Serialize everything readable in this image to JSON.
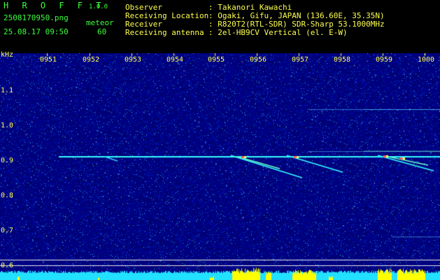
{
  "app": {
    "name": "H R O F F T",
    "version": "1.0.0"
  },
  "file": {
    "name": "2508170950.png",
    "datetime": "25.08.17 09:50"
  },
  "meteor": {
    "label": "meteor",
    "count": "60"
  },
  "info": [
    {
      "key": "Observer",
      "value": ": Takanori Kawachi"
    },
    {
      "key": "Receiving Location",
      "value": ": Ogaki, Gifu, JAPAN (136.60E, 35.35N)"
    },
    {
      "key": "Receiver",
      "value": ": R820T2(RTL-SDR) SDR-Sharp 53.1000MHz"
    },
    {
      "key": "Receiving antenna",
      "value": ": 2el-HB9CV Vertical (el. E-W)"
    }
  ],
  "axis": {
    "unit": "kHz",
    "time_ticks": [
      "0951",
      "0952",
      "0953",
      "0954",
      "0955",
      "0956",
      "0957",
      "0958",
      "0959",
      "1000"
    ],
    "freq_ticks": [
      "1.1",
      "1.0",
      "0.9",
      "0.8",
      "0.7",
      "0.6"
    ]
  },
  "colors": {
    "header_green": "#3cff3c",
    "label_yellow": "#ffff50",
    "plot_blue": "#0a0a8c",
    "signal_cyan": "#33ffff",
    "bar_yellow": "#ffff00"
  }
}
